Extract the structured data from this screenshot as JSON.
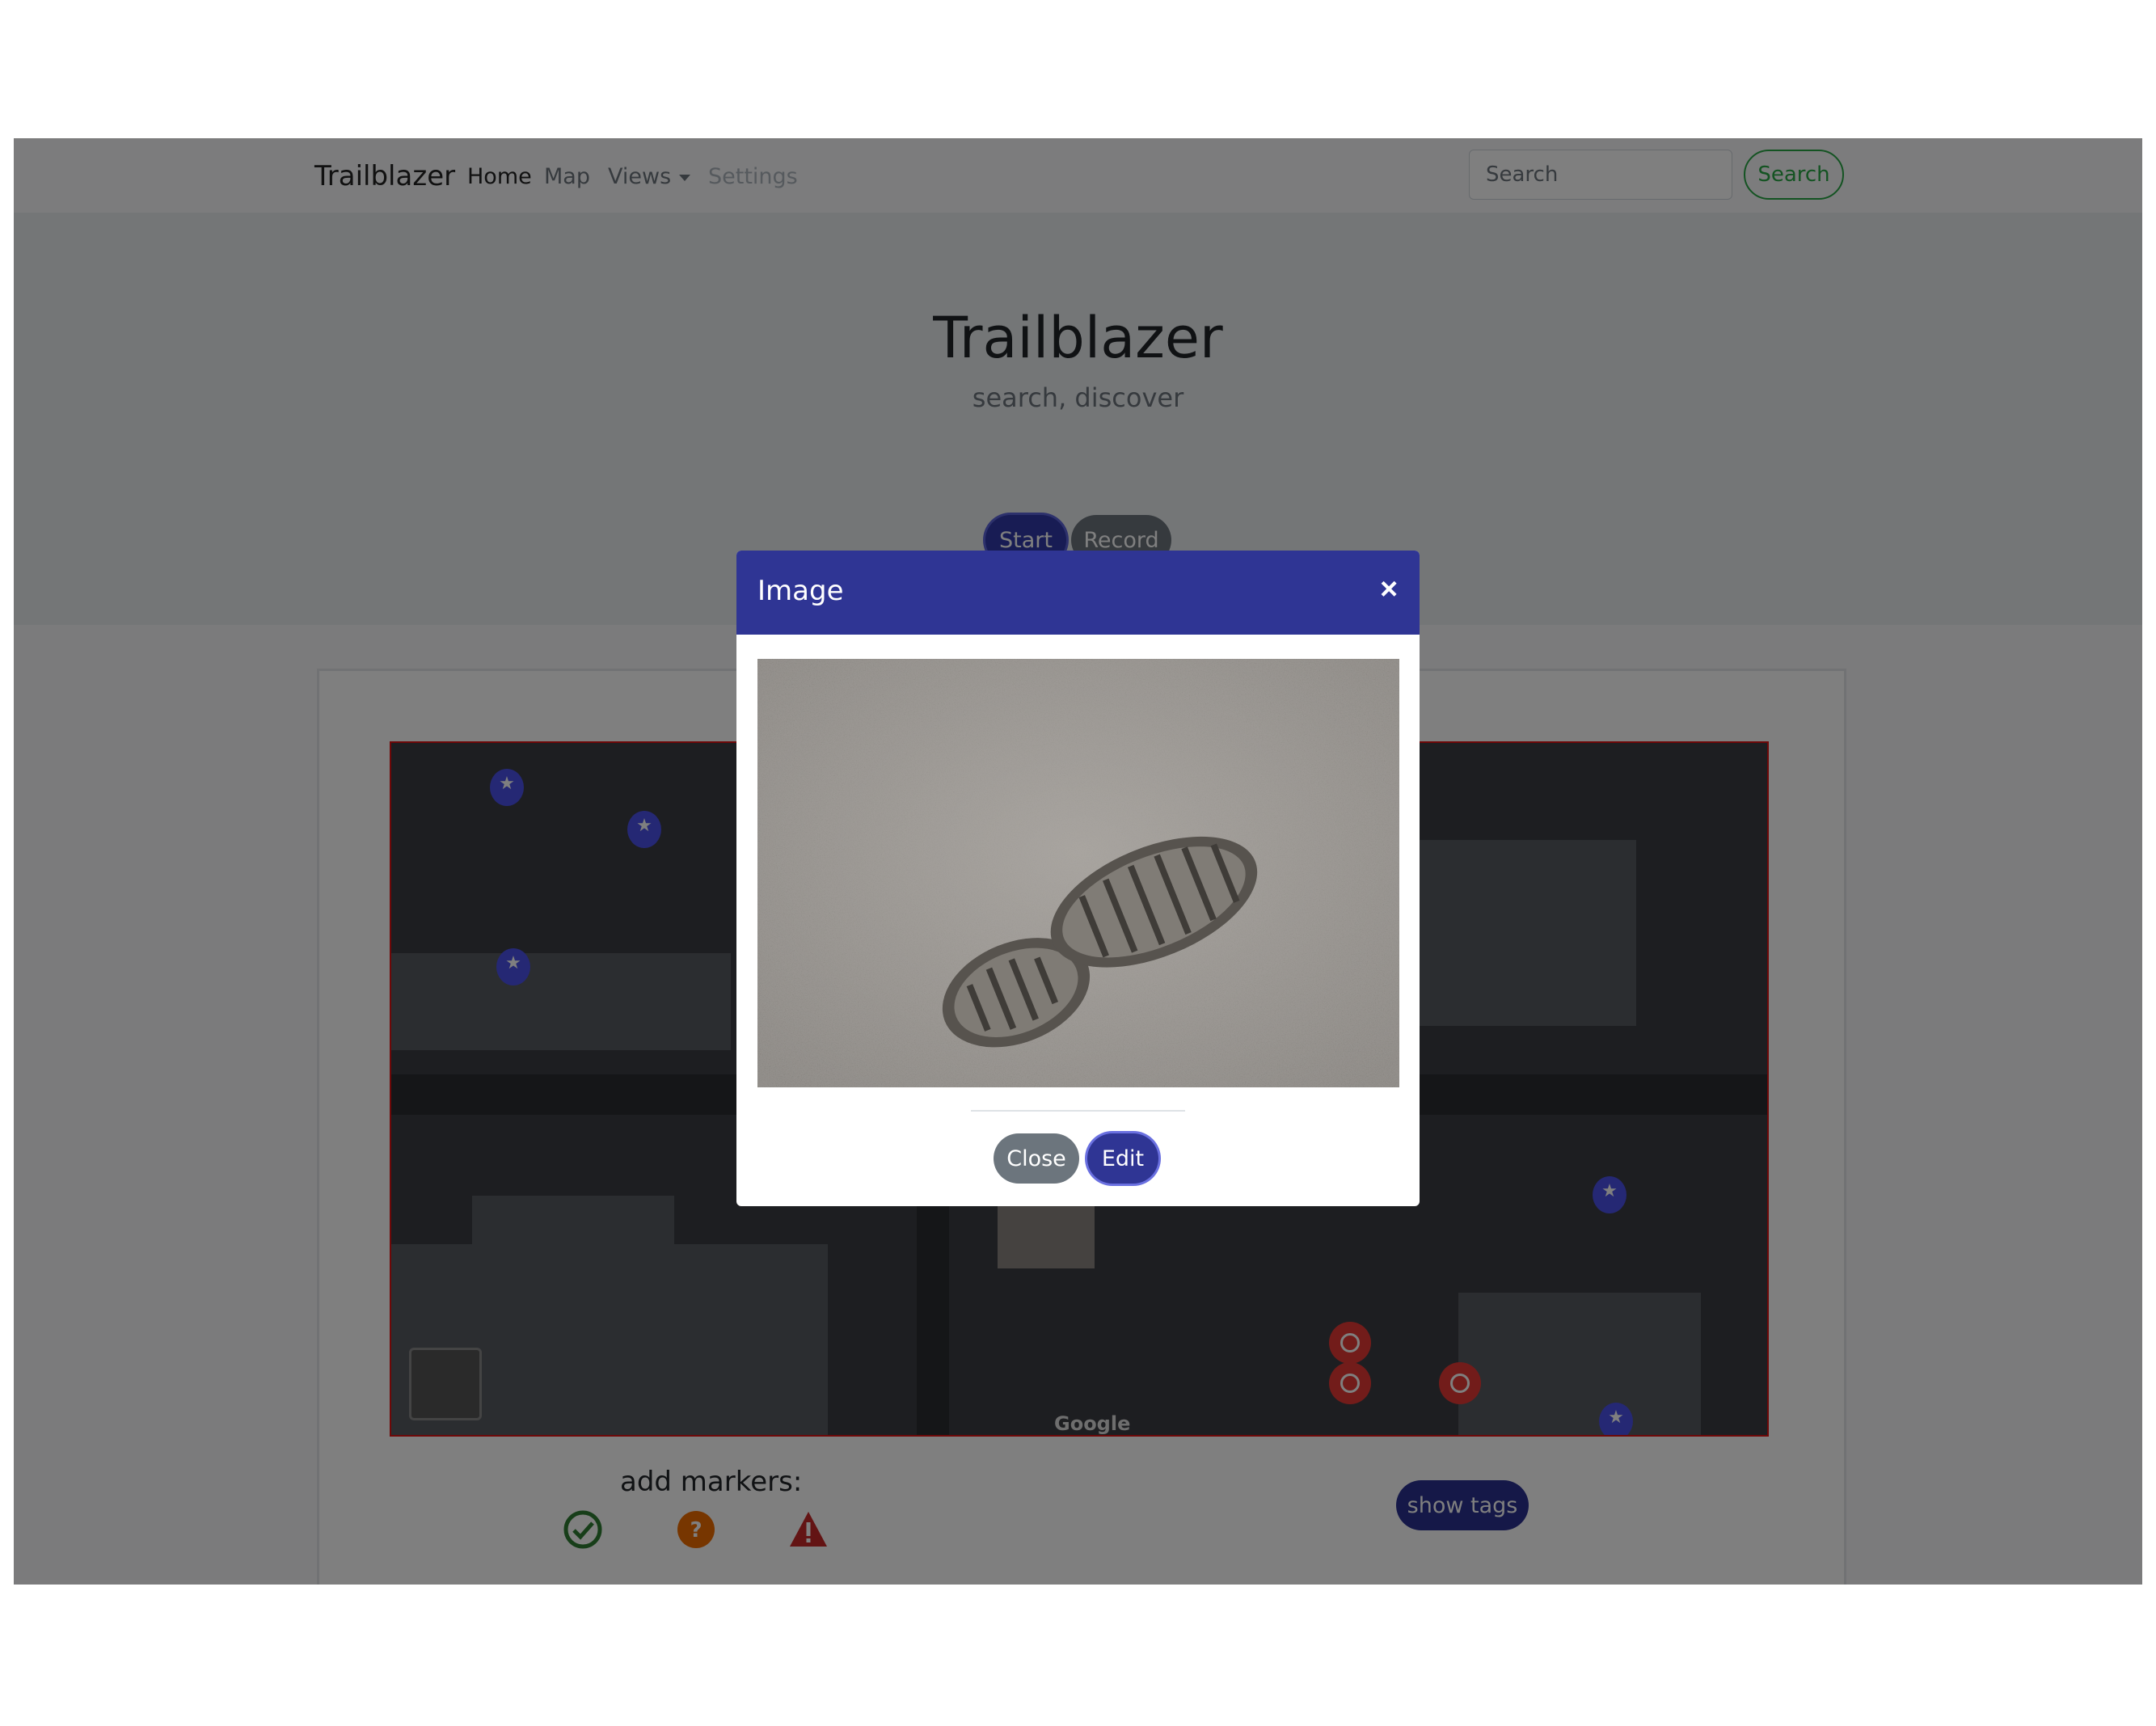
{
  "navbar": {
    "brand": "Trailblazer",
    "links": [
      {
        "label": "Home",
        "state": "active"
      },
      {
        "label": "Map",
        "state": "normal"
      },
      {
        "label": "Views",
        "state": "dropdown"
      },
      {
        "label": "Settings",
        "state": "disabled"
      }
    ],
    "search_placeholder": "Search",
    "search_button": "Search"
  },
  "hero": {
    "title": "Trailblazer",
    "subtitle": "search, discover",
    "start_button": "Start",
    "record_button": "Record"
  },
  "content": {
    "map_logo": "Google",
    "add_markers_label": "add markers:",
    "marker_icons": [
      "check-circle-icon",
      "question-circle-icon",
      "warning-triangle-icon"
    ],
    "show_tags_button": "show tags"
  },
  "modal": {
    "title": "Image",
    "close_symbol": "×",
    "close_button": "Close",
    "edit_button": "Edit"
  },
  "colors": {
    "primary": "#2f3594",
    "success": "#28a745",
    "secondary": "#6c757d",
    "danger": "#c62828",
    "warning": "#ef6c00"
  }
}
